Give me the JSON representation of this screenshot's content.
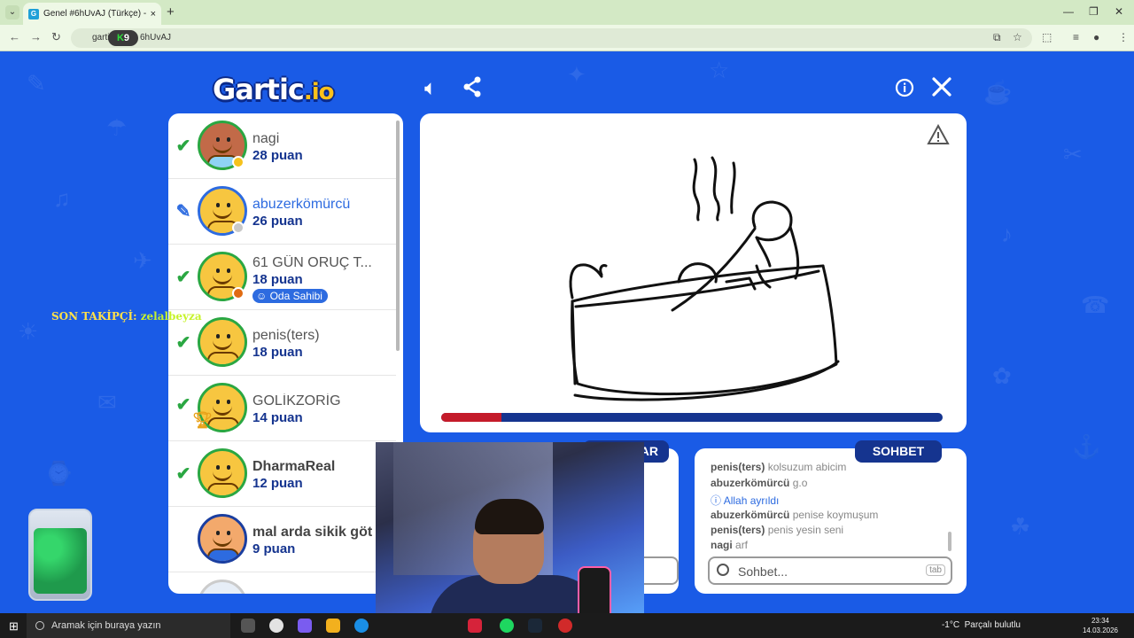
{
  "browser": {
    "tab_title": "Genel #6hUvAJ (Türkçe) - Gartic.io",
    "tab_favicon": "G",
    "address_prefix": "gartic",
    "address_suffix": "6hUvAJ",
    "k9_badge_k": "K",
    "k9_badge_9": "9",
    "new_tab": "+",
    "close_tab": "×"
  },
  "logo": {
    "main": "Gartic",
    "suffix": ".io"
  },
  "header_icons": {
    "sound": "speaker-icon",
    "share": "share-icon",
    "info": "info-icon",
    "close": "close-icon"
  },
  "players": [
    {
      "name": "nagi",
      "score": "28 puan",
      "status": "check",
      "dot": "#f6c21c",
      "style": "dark-skin"
    },
    {
      "name": "abuzerkömürcü",
      "score": "26 puan",
      "status": "pen",
      "dot": "#c9c9c9",
      "self": true
    },
    {
      "name": "61 GÜN ORUÇ T...",
      "score": "18 puan",
      "status": "check",
      "dot": "#e06b12",
      "badge": "Oda Sahibi"
    },
    {
      "name": "penis(ters)",
      "score": "18 puan",
      "status": "check"
    },
    {
      "name": "GOLİKZORİG",
      "score": "14 puan",
      "status": "check",
      "trophy": true
    },
    {
      "name": "DharmaReal",
      "score": "12 puan",
      "status": "check",
      "bold": true
    },
    {
      "name": "mal arda sikik göt",
      "score": "9 puan",
      "status": "none",
      "style": "glasses",
      "bold": true
    }
  ],
  "canvas": {
    "timer_progress": 0.12,
    "warning_icon": "warning-icon"
  },
  "answers": {
    "tab_label": "CEVAPLAR",
    "tab_visible_text": "AR"
  },
  "chat": {
    "tab_label": "SOHBET",
    "placeholder": "Sohbet...",
    "tab_hint": "tab",
    "messages": [
      {
        "user": "penis(ters)",
        "text": "kolsuzum abicim"
      },
      {
        "user": "abuzerkömürcü",
        "text": "g.o"
      },
      {
        "system": true,
        "text": "Allah ayrıldı"
      },
      {
        "user": "abuzerkömürcü",
        "text": "penise koymuşum"
      },
      {
        "user": "penis(ters)",
        "text": "penis yesin seni"
      },
      {
        "user": "nagi",
        "text": "arf"
      }
    ]
  },
  "overlay": {
    "follower_label": "SON TAKİPÇİ:",
    "follower_name": "zelalbeyza"
  },
  "taskbar": {
    "search_placeholder": "Aramak için buraya yazın",
    "weather_temp": "-1°C",
    "weather_text": "Parçalı bulutlu",
    "time": "23:34",
    "date": "14.03.2026"
  }
}
